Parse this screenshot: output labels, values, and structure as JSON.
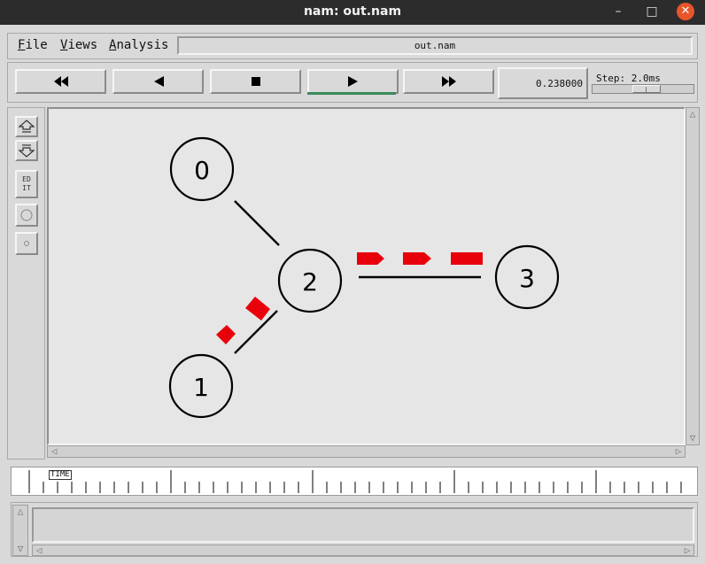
{
  "window": {
    "title": "nam: out.nam",
    "minimize_glyph": "–",
    "maximize_glyph": "□",
    "close_glyph": "✕"
  },
  "menu": {
    "items": [
      {
        "label": "File",
        "mnemonic": "F"
      },
      {
        "label": "Views",
        "mnemonic": "V"
      },
      {
        "label": "Analysis",
        "mnemonic": "A"
      }
    ],
    "file_name": "out.nam"
  },
  "playback": {
    "buttons": [
      {
        "name": "fast-rewind",
        "icon": "fast-rewind-icon"
      },
      {
        "name": "rewind",
        "icon": "play-backward-icon"
      },
      {
        "name": "stop",
        "icon": "stop-icon"
      },
      {
        "name": "play",
        "icon": "play-icon",
        "active": true
      },
      {
        "name": "fast-forward",
        "icon": "fast-forward-icon"
      }
    ],
    "current_time": "0.238000",
    "step_label": "Step: 2.0ms",
    "active_color": "#3a8a5a"
  },
  "side_tools": {
    "zoom_in_icon": "zoom-in-icon",
    "zoom_out_icon": "zoom-out-icon",
    "edit_label_1": "ED",
    "edit_label_2": "IT",
    "circle_icon": "circle-tool-icon",
    "dot_icon": "small-circle-tool-icon"
  },
  "topology": {
    "nodes": [
      {
        "id": "0"
      },
      {
        "id": "1"
      },
      {
        "id": "2"
      },
      {
        "id": "3"
      }
    ],
    "links": [
      {
        "from": "0",
        "to": "2"
      },
      {
        "from": "1",
        "to": "2"
      },
      {
        "from": "2",
        "to": "3"
      }
    ],
    "packet_color": "#e8000b",
    "link_color": "#000000"
  },
  "timeline": {
    "label": "TIME"
  }
}
